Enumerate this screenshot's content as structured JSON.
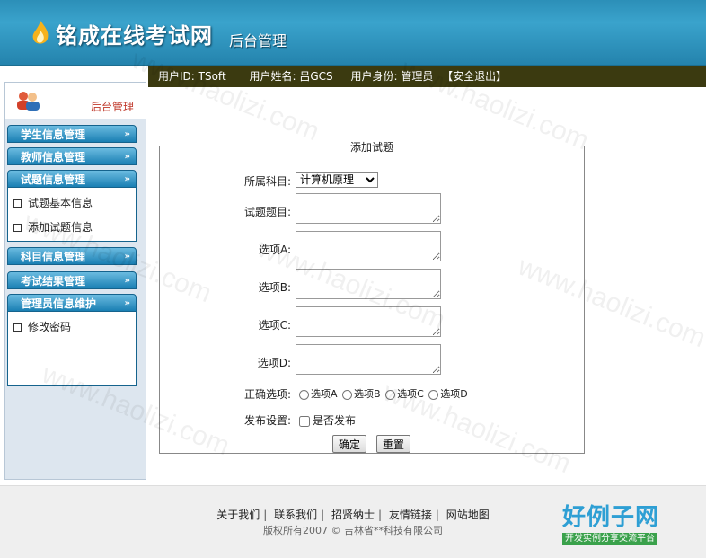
{
  "header": {
    "brand": "铭成在线考试网",
    "subtitle": "后台管理"
  },
  "infobar": {
    "user_id": "用户ID: TSoft",
    "user_name": "用户姓名: 吕GCS",
    "user_role": "用户身份: 管理员",
    "logout": "【安全退出】"
  },
  "sidebar": {
    "title": "后台管理",
    "groups": [
      {
        "label": "学生信息管理",
        "chevron": "»"
      },
      {
        "label": "教师信息管理",
        "chevron": "»"
      },
      {
        "label": "试题信息管理",
        "chevron": "»",
        "items": [
          "试题基本信息",
          "添加试题信息"
        ]
      },
      {
        "label": "科目信息管理",
        "chevron": "»"
      },
      {
        "label": "考试结果管理",
        "chevron": "»"
      },
      {
        "label": "管理员信息维护",
        "chevron": "»",
        "items": [
          "修改密码"
        ]
      }
    ]
  },
  "form": {
    "legend": "添加试题",
    "subject_label": "所属科目:",
    "subject_value": "计算机原理",
    "question_label": "试题题目:",
    "option_a_label": "选项A:",
    "option_b_label": "选项B:",
    "option_c_label": "选项C:",
    "option_d_label": "选项D:",
    "answer_label": "正确选项:",
    "answers": [
      "选项A",
      "选项B",
      "选项C",
      "选项D"
    ],
    "publish_label": "发布设置:",
    "publish_checkbox": "是否发布",
    "submit": "确定",
    "reset": "重置"
  },
  "footer": {
    "links": [
      "关于我们",
      "联系我们",
      "招贤纳士",
      "友情链接",
      "网站地图"
    ],
    "copyright": "版权所有2007 © 吉林省**科技有限公司",
    "logo_title": "好例子网",
    "logo_sub": "开发实例分享交流平台"
  },
  "watermark": "www.haolizi.com"
}
